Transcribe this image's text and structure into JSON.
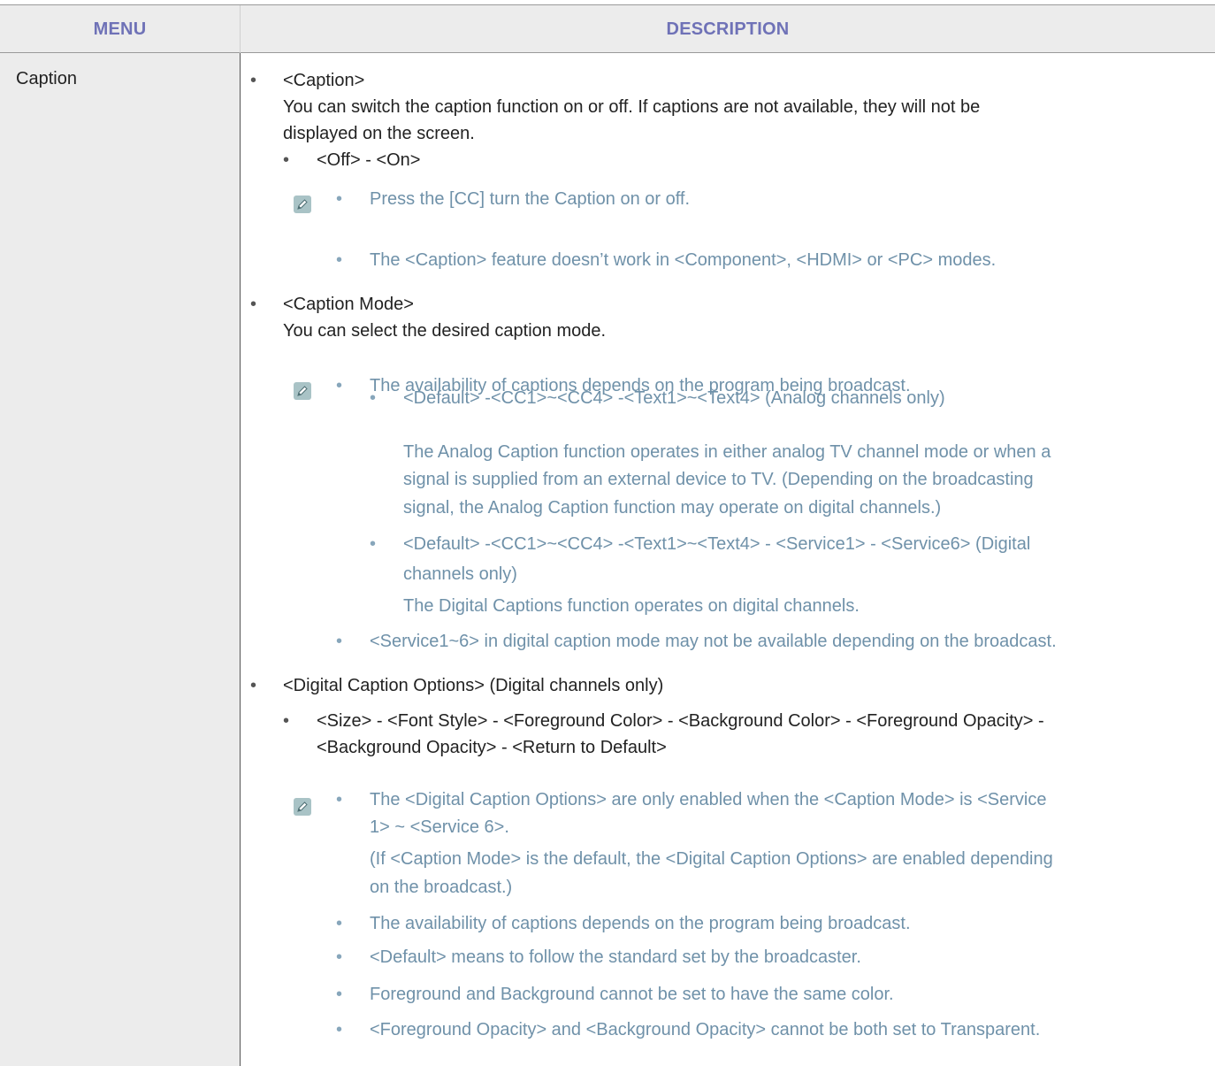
{
  "header": {
    "menu": "MENU",
    "description": "DESCRIPTION"
  },
  "menu_item": "Caption",
  "s1": {
    "title": "<Caption>",
    "desc1": "You can switch the caption function on or off. If captions are not available, they will not be",
    "desc2": "displayed on the screen.",
    "options": "<Off> - <On>",
    "note1": "Press the [CC] turn the Caption on or off.",
    "note2": "The <Caption> feature doesn’t work in <Component>, <HDMI> or <PC> modes."
  },
  "s2": {
    "title": "<Caption Mode>",
    "desc": "You can select the desired caption mode.",
    "note1": "The availability of captions depends on the program being broadcast.",
    "a1": "<Default> -<CC1>~<CC4> -<Text1>~<Text4> (Analog channels only)",
    "a2": "The Analog Caption function operates in either analog TV channel mode or when a",
    "a3": "signal is supplied from an external device to TV. (Depending on the broadcasting",
    "a4": "signal, the Analog Caption function may operate on digital channels.)",
    "d1": "<Default> -<CC1>~<CC4> -<Text1>~<Text4> - <Service1> - <Service6> (Digital",
    "d2": "channels only)",
    "d3": "The Digital Captions function operates on digital channels.",
    "note2": "<Service1~6> in digital caption mode may not be available depending on the broadcast."
  },
  "s3": {
    "title": "<Digital Caption Options> (Digital channels only)",
    "opt1": "<Size> - <Font Style> - <Foreground Color> - <Background Color> - <Foreground Opacity> -",
    "opt2": "<Background Opacity> - <Return to Default>",
    "n1a": "The <Digital Caption Options> are only enabled when the <Caption Mode> is <Service",
    "n1b": "1> ~ <Service 6>.",
    "n1c": "(If <Caption Mode> is the default, the <Digital Caption Options> are enabled depending",
    "n1d": "on the broadcast.)",
    "n2": "The availability of captions depends on the program being broadcast.",
    "n3": "<Default> means to follow the standard set by the broadcaster.",
    "n4": "Foreground and Background cannot be set to have the same color.",
    "n5": "<Foreground Opacity> and <Background Opacity> cannot be both set to Transparent."
  },
  "bullet": "•",
  "colors": {
    "header_text": "#6f72b7",
    "note_text": "#6f91a9",
    "header_bg": "#ececec",
    "note_icon": "#a9c3c6"
  },
  "icons": {
    "note": "note-pencil-icon"
  }
}
